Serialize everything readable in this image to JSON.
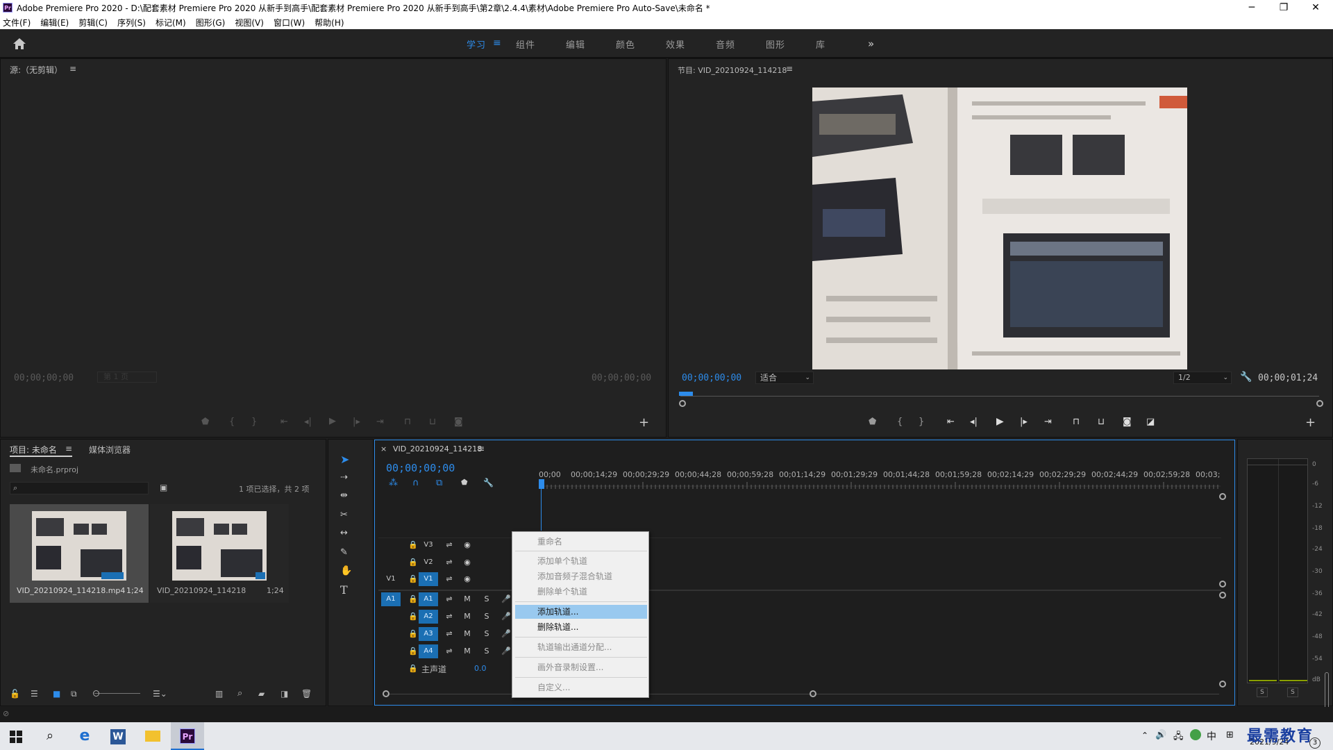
{
  "window": {
    "title": "Adobe Premiere Pro 2020 - D:\\配套素材 Premiere Pro 2020 从新手到高手\\配套素材 Premiere Pro 2020 从新手到高手\\第2章\\2.4.4\\素材\\Adobe Premiere Pro Auto-Save\\未命名 *",
    "app_icon": "Pr",
    "minimize": "─",
    "restore": "❐",
    "close": "✕"
  },
  "menu": [
    "文件(F)",
    "编辑(E)",
    "剪辑(C)",
    "序列(S)",
    "标记(M)",
    "图形(G)",
    "视图(V)",
    "窗口(W)",
    "帮助(H)"
  ],
  "workspaces": {
    "tabs": [
      "学习",
      "组件",
      "编辑",
      "颜色",
      "效果",
      "音频",
      "图形",
      "库"
    ],
    "active": "学习",
    "more": "»",
    "menu_glyph": "≡"
  },
  "source": {
    "title": "源:（无剪辑）",
    "menu_glyph": "≡",
    "timecode_left": "00;00;00;00",
    "page": "第 1 页",
    "timecode_right": "00;00;00;00",
    "add": "+"
  },
  "program": {
    "title": "节目: VID_20210924_114218",
    "menu_glyph": "≡",
    "timecode": "00;00;00;00",
    "fit": "适合",
    "resolution": "1/2",
    "duration": "00;00;01;24",
    "add": "+"
  },
  "project": {
    "tab_project": "项目: 未命名",
    "menu_glyph": "≡",
    "tab_media": "媒体浏览器",
    "file": "未命名.prproj",
    "search_placeholder": "",
    "selection": "1 项已选择，共 2 项",
    "items": [
      {
        "name": "VID_20210924_114218.mp4",
        "duration": "1;24"
      },
      {
        "name": "VID_20210924_114218",
        "duration": "1;24"
      }
    ]
  },
  "timeline": {
    "tab": "VID_20210924_114218",
    "close": "×",
    "menu_glyph": "≡",
    "timecode": "00;00;00;00",
    "ruler": [
      "00;00",
      "00;00;14;29",
      "00;00;29;29",
      "00;00;44;28",
      "00;00;59;28",
      "00;01;14;29",
      "00;01;29;29",
      "00;01;44;28",
      "00;01;59;28",
      "00;02;14;29",
      "00;02;29;29",
      "00;02;44;29",
      "00;02;59;28",
      "00;03;"
    ],
    "video_tracks": [
      "V3",
      "V2",
      "V1"
    ],
    "source_v": "V1",
    "source_a": "A1",
    "audio_tracks": [
      "A1",
      "A2",
      "A3",
      "A4"
    ],
    "master_label": "主声道",
    "master_value": "0.0",
    "mute": "M",
    "solo": "S"
  },
  "context_menu": {
    "items": [
      {
        "label": "重命名",
        "enabled": false
      },
      {
        "label": "添加单个轨道",
        "enabled": false
      },
      {
        "label": "添加音频子混合轨道",
        "enabled": false
      },
      {
        "label": "删除单个轨道",
        "enabled": false
      },
      {
        "label": "添加轨道...",
        "enabled": true,
        "highlighted": true
      },
      {
        "label": "删除轨道...",
        "enabled": true
      },
      {
        "label": "轨道输出通道分配...",
        "enabled": false
      },
      {
        "label": "画外音录制设置...",
        "enabled": false
      },
      {
        "label": "自定义...",
        "enabled": false
      }
    ]
  },
  "audio_meter": {
    "scale": [
      "0",
      "-6",
      "-12",
      "-18",
      "-24",
      "-30",
      "-36",
      "-42",
      "-48",
      "-54",
      "dB"
    ],
    "solo_left": "S",
    "solo_right": "S"
  },
  "taskbar": {
    "ime": "中",
    "date": "2021/9/24",
    "notification_count": "3",
    "watermark": "最需教育"
  },
  "colors": {
    "accent": "#2d8ceb",
    "track_on": "#1b6fb3",
    "menu_highlight": "#99c9ef",
    "panel_bg": "#232323"
  }
}
